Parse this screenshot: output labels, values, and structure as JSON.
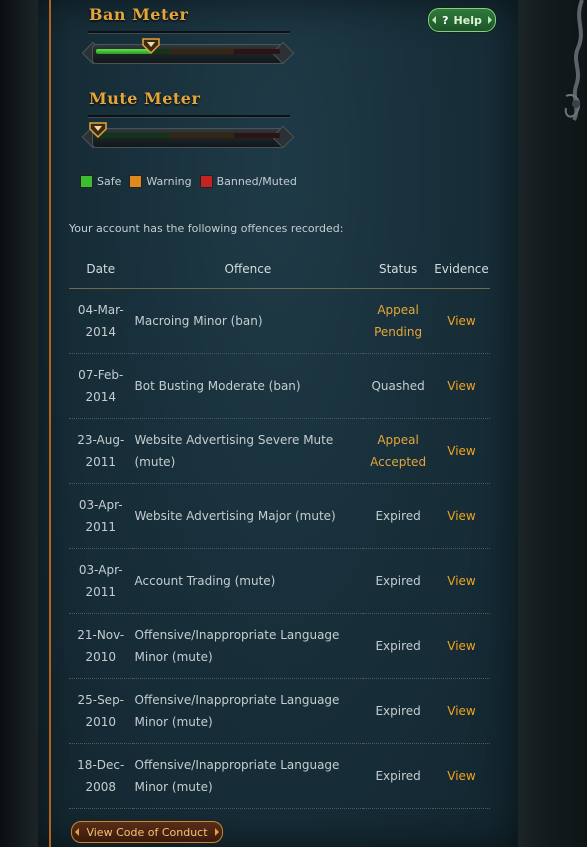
{
  "meters": {
    "ban": {
      "title": "Ban Meter",
      "level_fraction": 0.3
    },
    "mute": {
      "title": "Mute Meter",
      "level_fraction": 0.0
    }
  },
  "help": {
    "label": "Help",
    "icon": "question-icon"
  },
  "legend": [
    {
      "label": "Safe",
      "color": "#3bbf2f"
    },
    {
      "label": "Warning",
      "color": "#e08a1e"
    },
    {
      "label": "Banned/Muted",
      "color": "#c62424"
    }
  ],
  "intro_text": "Your account has the following offences recorded:",
  "table": {
    "headers": {
      "date": "Date",
      "offence": "Offence",
      "status": "Status",
      "evidence": "Evidence"
    },
    "rows": [
      {
        "date_line1": "04-Mar-",
        "date_line2": "2014",
        "offence": "Macroing Minor (ban)",
        "status_line1": "Appeal",
        "status_line2": "Pending",
        "evidence": "View"
      },
      {
        "date_line1": "07-Feb-",
        "date_line2": "2014",
        "offence": "Bot Busting Moderate (ban)",
        "status_line1": "Quashed",
        "status_line2": "",
        "evidence": "View"
      },
      {
        "date_line1": "23-Aug-",
        "date_line2": "2011",
        "offence": "Website Advertising Severe Mute (mute)",
        "status_line1": "Appeal",
        "status_line2": "Accepted",
        "evidence": "View"
      },
      {
        "date_line1": "03-Apr-",
        "date_line2": "2011",
        "offence": "Website Advertising Major (mute)",
        "status_line1": "Expired",
        "status_line2": "",
        "evidence": "View"
      },
      {
        "date_line1": "03-Apr-",
        "date_line2": "2011",
        "offence": "Account Trading (mute)",
        "status_line1": "Expired",
        "status_line2": "",
        "evidence": "View"
      },
      {
        "date_line1": "21-Nov-",
        "date_line2": "2010",
        "offence": "Offensive/Inappropriate Language Minor (mute)",
        "status_line1": "Expired",
        "status_line2": "",
        "evidence": "View"
      },
      {
        "date_line1": "25-Sep-",
        "date_line2": "2010",
        "offence": "Offensive/Inappropriate Language Minor (mute)",
        "status_line1": "Expired",
        "status_line2": "",
        "evidence": "View"
      },
      {
        "date_line1": "18-Dec-",
        "date_line2": "2008",
        "offence": "Offensive/Inappropriate Language Minor (mute)",
        "status_line1": "Expired",
        "status_line2": "",
        "evidence": "View"
      }
    ]
  },
  "conduct_button": {
    "label": "View Code of Conduct"
  },
  "colors": {
    "accent": "#e4a63a",
    "link": "#f0a420",
    "panel": "#18303b"
  }
}
